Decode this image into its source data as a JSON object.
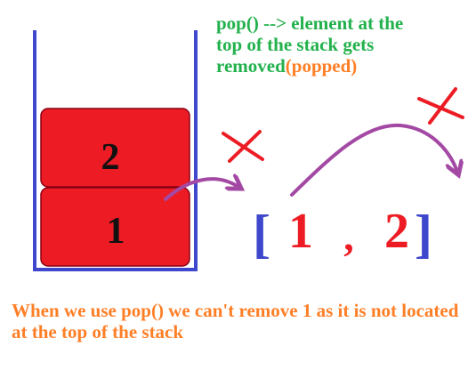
{
  "heading": {
    "line1": "pop() --> element at the",
    "line2": "top of the stack gets",
    "line3_main": "removed",
    "line3_accent": "(popped)"
  },
  "stack": {
    "top_item": "2",
    "bottom_item": "1"
  },
  "array": {
    "open_bracket": "[",
    "first": "1",
    "comma": ",",
    "second": "2",
    "close_bracket": "]"
  },
  "note": {
    "text": "When we use pop() we can't remove 1 as it is not located at the top of the stack"
  },
  "colors": {
    "stack_outline": "#3f48cc",
    "block_fill": "#ed1c24",
    "block_border": "#880015",
    "bracket": "#3f48cc",
    "array_number": "#ed1c24",
    "arrow": "#a349a4",
    "cross": "#ed1c24",
    "heading": "#22b14c",
    "accent": "#ff7f27"
  },
  "icons": [
    "cross-icon",
    "curved-arrow-icon"
  ]
}
